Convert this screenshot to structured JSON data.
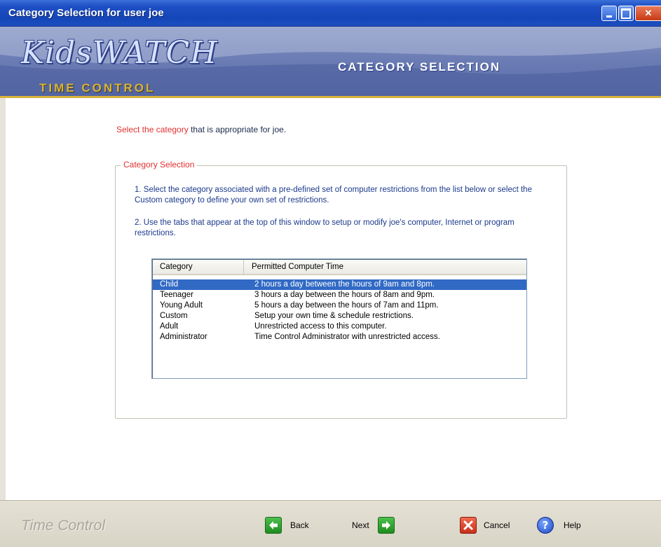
{
  "window": {
    "title": "Category Selection for user joe"
  },
  "banner": {
    "logo_text": "KidsWATCH",
    "logo_subtext": "TIME CONTROL",
    "heading": "CATEGORY SELECTION"
  },
  "content": {
    "intro_highlight": "Select the category",
    "intro_rest": " that is appropriate for joe.",
    "group_title": "Category Selection",
    "step1": "1. Select the category associated with a pre-defined set of computer restrictions from the list below or select the Custom category to define your own set of restrictions.",
    "step2": "2. Use the tabs that appear at the top of this window to setup or modify joe's computer, Internet or program restrictions."
  },
  "listview": {
    "columns": [
      "Category",
      "Permitted Computer Time"
    ],
    "rows": [
      {
        "category": "Child",
        "time": "2 hours a day between the hours of 9am and 8pm.",
        "selected": true
      },
      {
        "category": "Teenager",
        "time": "3 hours a day between the hours of 8am and 9pm.",
        "selected": false
      },
      {
        "category": "Young Adult",
        "time": "5 hours a day between the hours of 7am and 11pm.",
        "selected": false
      },
      {
        "category": "Custom",
        "time": "Setup your own time & schedule restrictions.",
        "selected": false
      },
      {
        "category": "Adult",
        "time": "Unrestricted access to this computer.",
        "selected": false
      },
      {
        "category": "Administrator",
        "time": "Time Control Administrator with unrestricted access.",
        "selected": false
      }
    ]
  },
  "footer": {
    "brand": "Time Control",
    "back_label": "Back",
    "next_label": "Next",
    "cancel_label": "Cancel",
    "help_label": "Help"
  },
  "icons": {
    "back": "arrow-left-icon",
    "next": "arrow-right-icon",
    "cancel": "x-icon",
    "help": "question-icon"
  },
  "colors": {
    "title_bar": "#1546b8",
    "selection": "#316ac5",
    "highlight_red": "#e03030",
    "step_blue": "#1b3a8c",
    "accent_gold": "#d9b23a"
  }
}
